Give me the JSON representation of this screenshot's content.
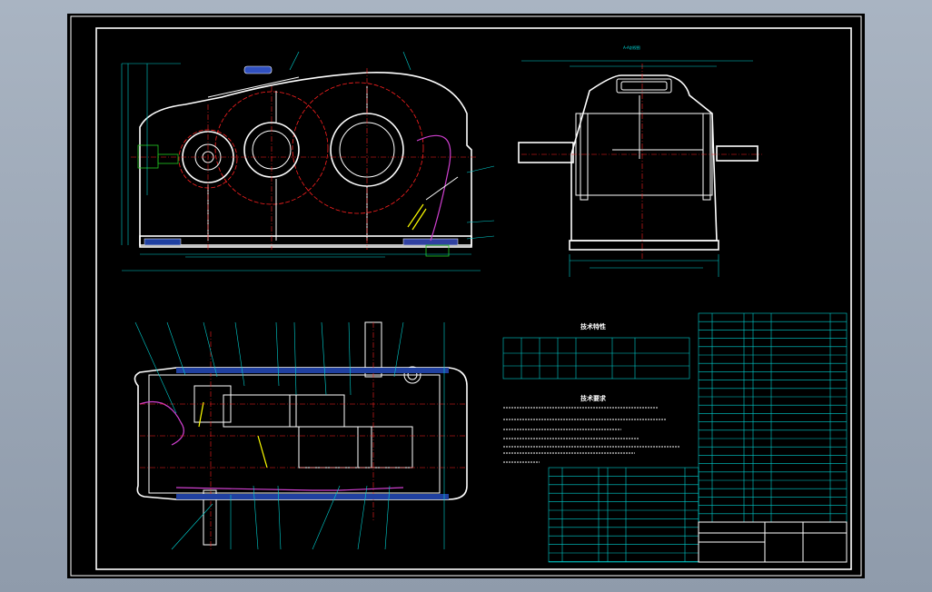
{
  "drawing": {
    "title_right_view": "A-A剖视图",
    "tech_params_title": "技术特性",
    "tech_requirements_title": "技术要求"
  },
  "colors": {
    "outline": "#ffffff",
    "dimension": "#00d0d0",
    "centerline": "#ff2020",
    "section": "#d040d0",
    "highlight": "#ffff00",
    "hatch": "#3060ff"
  }
}
